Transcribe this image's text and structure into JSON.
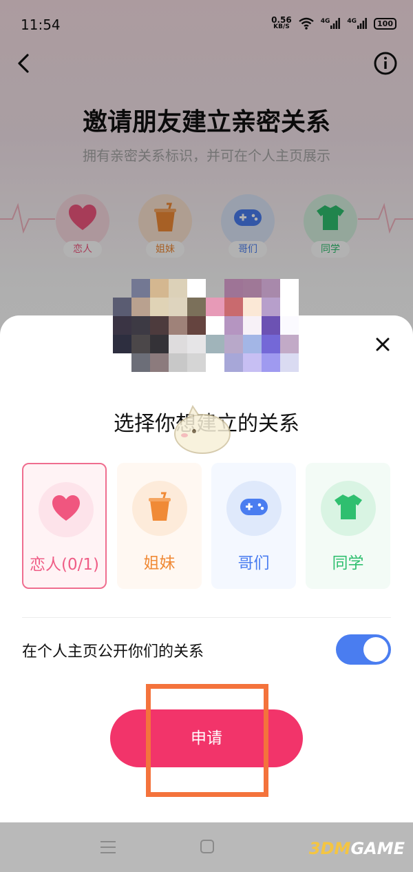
{
  "status_bar": {
    "time": "11:54",
    "net_speed": "0.56",
    "net_unit": "KB/S",
    "signal_1": "4G",
    "signal_2": "4G",
    "battery": "100"
  },
  "header": {
    "title": "邀请朋友建立亲密关系",
    "subtitle": "拥有亲密关系标识，并可在个人主页展示"
  },
  "background_relations": [
    {
      "label": "恋人",
      "icon": "heart-icon",
      "color": "#f0567f"
    },
    {
      "label": "姐妹",
      "icon": "drink-cup-icon",
      "color": "#f08a36"
    },
    {
      "label": "哥们",
      "icon": "gamepad-icon",
      "color": "#4a7df0"
    },
    {
      "label": "同学",
      "icon": "tshirt-icon",
      "color": "#2fbf6f"
    }
  ],
  "sheet": {
    "title": "选择你想建立的关系",
    "relations": [
      {
        "label": "恋人(0/1)",
        "icon": "heart-icon",
        "color": "#ef5d86",
        "selected": true
      },
      {
        "label": "姐妹",
        "icon": "drink-cup-icon",
        "color": "#f08a36",
        "selected": false
      },
      {
        "label": "哥们",
        "icon": "gamepad-icon",
        "color": "#4a7df0",
        "selected": false
      },
      {
        "label": "同学",
        "icon": "tshirt-icon",
        "color": "#2fbf6f",
        "selected": false
      }
    ],
    "public_toggle_label": "在个人主页公开你们的关系",
    "public_toggle_on": true,
    "apply_button": "申请"
  },
  "watermark": {
    "part1": "3DM",
    "part2": "GAME"
  },
  "colors": {
    "accent_pink": "#f2346a",
    "toggle_blue": "#4a7df0",
    "highlight_orange": "#f4733c"
  }
}
